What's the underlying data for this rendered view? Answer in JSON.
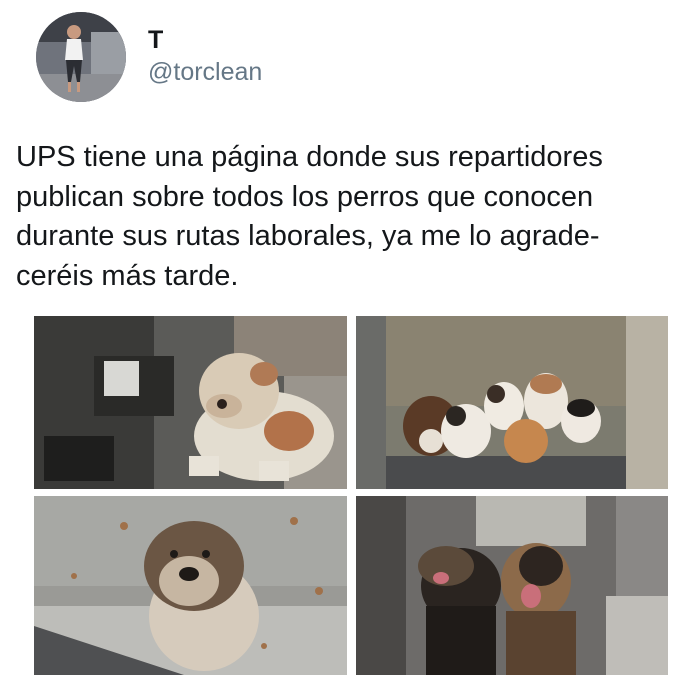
{
  "tweet": {
    "author": {
      "display_name": "T",
      "handle": "@torclean"
    },
    "text_lines": [
      "UPS tiene una página donde sus repartidores",
      "publican sobre todos los perros que conocen",
      "durante sus rutas laborales, ya me lo agrade-",
      "ceréis más tarde."
    ],
    "photos": [
      {
        "subject": "pit-bull-at-truck-step"
      },
      {
        "subject": "puppies-at-truck-door"
      },
      {
        "subject": "akita-puppy-on-step"
      },
      {
        "subject": "two-shepherds-in-truck"
      }
    ]
  },
  "colors": {
    "text": "#14171a",
    "secondary": "#657786",
    "background": "#ffffff"
  },
  "icons": [
    "avatar-photo"
  ]
}
